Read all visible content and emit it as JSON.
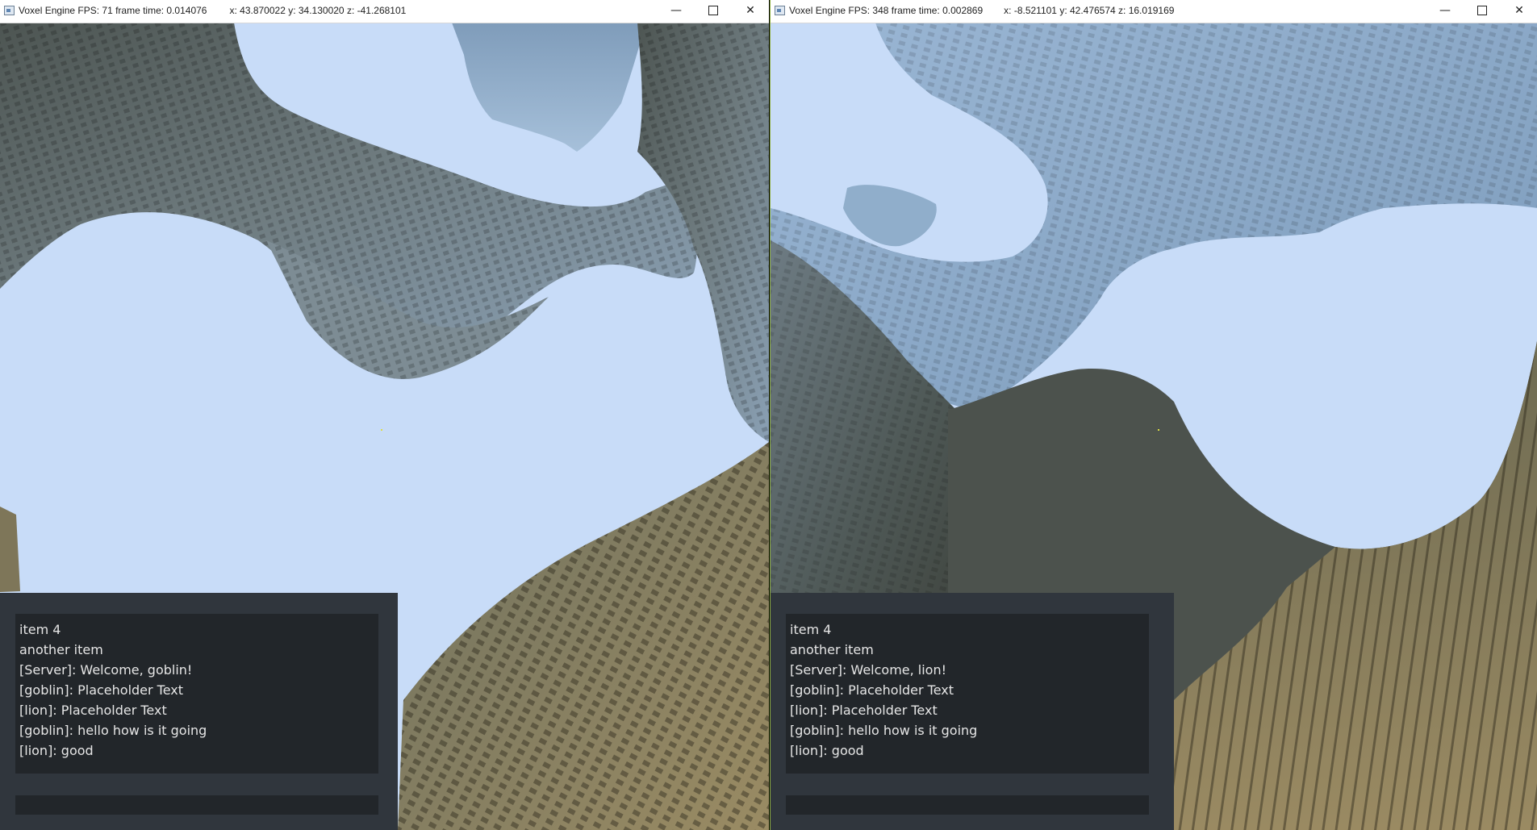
{
  "left_window": {
    "title": "Voxel Engine FPS: 71 frame time: 0.014076",
    "coords": "x: 43.870022 y: 34.130020 z: -41.268101",
    "controls": {
      "minimize": "—",
      "close": "✕"
    },
    "chat": {
      "messages": [
        "item 4",
        "another item",
        "[Server]: Welcome, goblin!",
        "[goblin]: Placeholder Text",
        "[lion]: Placeholder Text",
        "[goblin]: hello how is it going",
        "[lion]: good"
      ],
      "input_value": ""
    }
  },
  "right_window": {
    "title": "Voxel Engine FPS: 348 frame time: 0.002869",
    "coords": "x: -8.521101 y: 42.476574 z: 16.019169",
    "controls": {
      "minimize": "—",
      "close": "✕"
    },
    "chat": {
      "messages": [
        "item 4",
        "another item",
        "[Server]: Welcome, lion!",
        "[goblin]: Placeholder Text",
        "[lion]: Placeholder Text",
        "[goblin]: hello how is it going",
        "[lion]: good"
      ],
      "input_value": ""
    }
  },
  "colors": {
    "sky": "#c8dcf8",
    "terrain_dark": "#56605e",
    "terrain_blue": "#8fb0cf",
    "terrain_sand": "#8c7f5d",
    "chat_panel": "#30363d",
    "chat_log": "#22262a",
    "chat_text": "#e6e6e6",
    "window_divider": "#8fb040"
  }
}
